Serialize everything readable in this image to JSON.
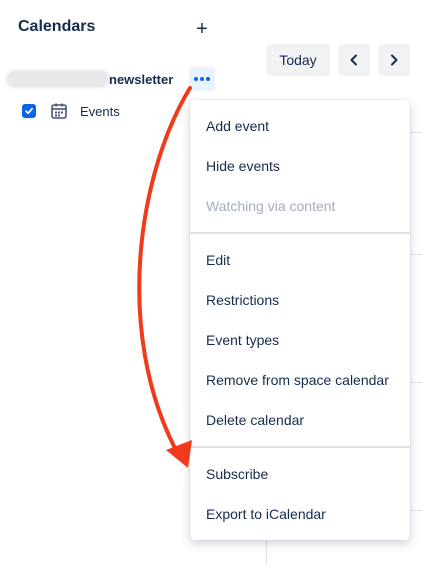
{
  "sidebar": {
    "title": "Calendars",
    "add_symbol": "+",
    "calendar_name": "newsletter",
    "sub_calendar_label": "Events"
  },
  "toolbar": {
    "today_label": "Today",
    "prev_symbol": "‹",
    "next_symbol": "›"
  },
  "menu": {
    "group1": [
      "Add event",
      "Hide events",
      "Watching via content"
    ],
    "group2": [
      "Edit",
      "Restrictions",
      "Event types",
      "Remove from space calendar",
      "Delete calendar"
    ],
    "group3": [
      "Subscribe",
      "Export to iCalendar"
    ]
  },
  "colors": {
    "accent": "#0c66e4",
    "annotation_arrow": "#f13a1c"
  },
  "icons": [
    "plus-icon",
    "more-dots-icon",
    "checkbox-checked-icon",
    "calendar-icon",
    "chevron-left-icon",
    "chevron-right-icon"
  ]
}
